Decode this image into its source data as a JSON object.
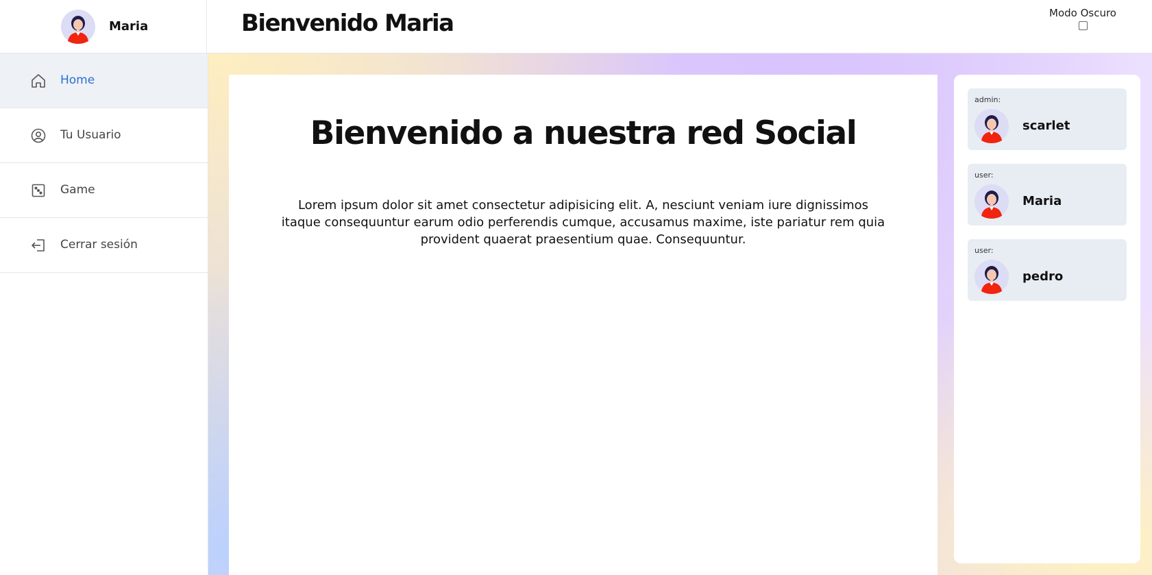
{
  "header": {
    "user_name": "Maria",
    "title": "Bienvenido Maria",
    "dark_mode_label": "Modo Oscuro",
    "dark_mode_checked": false
  },
  "sidebar": {
    "items": [
      {
        "label": "Home",
        "icon": "home-icon",
        "active": true
      },
      {
        "label": "Tu Usuario",
        "icon": "user-circle-icon",
        "active": false
      },
      {
        "label": "Game",
        "icon": "dice-icon",
        "active": false
      },
      {
        "label": "Cerrar sesión",
        "icon": "logout-icon",
        "active": false
      }
    ]
  },
  "main": {
    "heading": "Bienvenido a nuestra red Social",
    "body": "Lorem ipsum dolor sit amet consectetur adipisicing elit. A, nesciunt veniam iure dignissimos itaque consequuntur earum odio perferendis cumque, accusamus maxime, iste pariatur rem quia provident quaerat praesentium quae. Consequuntur."
  },
  "users": [
    {
      "role": "admin:",
      "name": "scarlet"
    },
    {
      "role": "user:",
      "name": "Maria"
    },
    {
      "role": "user:",
      "name": "pedro"
    }
  ],
  "colors": {
    "accent": "#2a6fd6",
    "active_nav_bg": "#eef1f5",
    "user_card_bg": "#e8ecf3"
  }
}
